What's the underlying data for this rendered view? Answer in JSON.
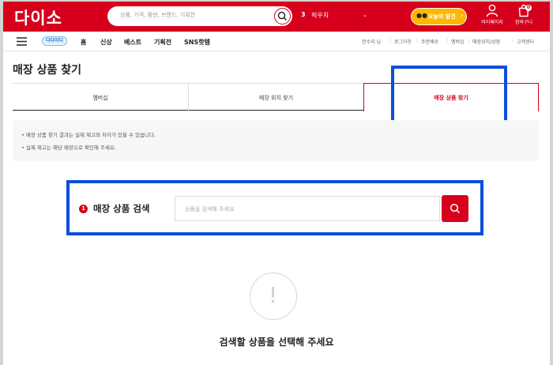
{
  "header": {
    "logo": "다이소",
    "search_placeholder": "상품, 가격, 품번, 브랜드, 기획전",
    "rank_number": "3",
    "rank_keyword": "픽우치",
    "today_discovery": "오늘의 발견",
    "mypage_label": "마이페이지",
    "cart_label": "장바구니",
    "cart_count": "0",
    "brand_color": "#d6001c"
  },
  "nav": {
    "badge": "다다이디",
    "links": [
      "홈",
      "신상",
      "베스트",
      "기획전",
      "SNS핫템"
    ],
    "util": [
      "전수지 님",
      "로그아웃",
      "주문배송",
      "멤버십",
      "매장위치/상점",
      "고객센터"
    ]
  },
  "page": {
    "title": "매장 상품 찾기",
    "tabs": [
      "멤버십",
      "매장 위치 찾기",
      "매장 상품 찾기"
    ],
    "active_tab": "매장 상품 찾기",
    "notices": [
      "• 매장 상품 찾기 결과는 실제 재고와 차이가 있을 수 있습니다.",
      "• 실제 재고는 해당 매장으로 확인해 주세요."
    ],
    "search": {
      "step": "1",
      "label": "매장 상품 검색",
      "placeholder": "상품을 검색해 주세요"
    },
    "empty": {
      "icon": "!",
      "message": "검색할 상품을 선택해 주세요"
    }
  },
  "highlight_color": "#0a4fd8"
}
